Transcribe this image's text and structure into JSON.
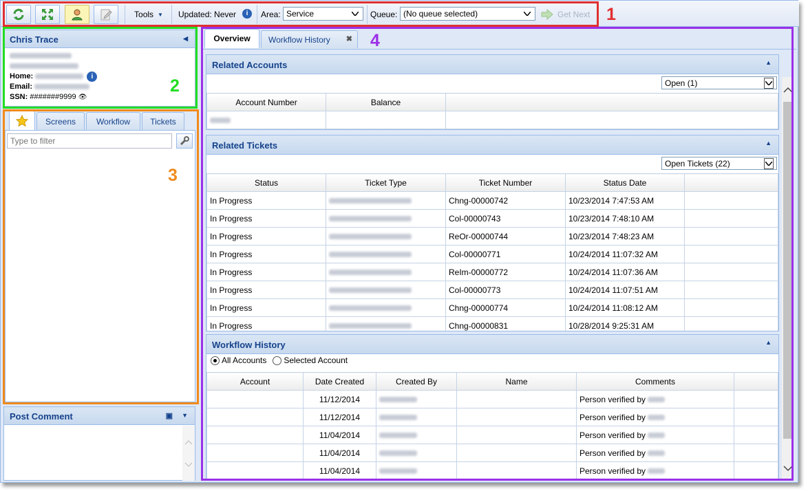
{
  "toolbar": {
    "tools_label": "Tools",
    "updated_label": "Updated: Never",
    "area_label": "Area:",
    "area_value": "Service",
    "queue_label": "Queue:",
    "queue_value": "(No queue selected)",
    "get_next_label": "Get Next"
  },
  "customer": {
    "name": "Chris Trace",
    "home_label": "Home:",
    "email_label": "Email:",
    "ssn_label": "SSN:",
    "ssn_value": "#######9999"
  },
  "left_tabs": [
    "Screens",
    "Workflow",
    "Tickets"
  ],
  "filter_placeholder": "Type to filter",
  "post_comment_title": "Post Comment",
  "main_tabs": {
    "overview": "Overview",
    "workflow_history": "Workflow History"
  },
  "related_accounts": {
    "title": "Related Accounts",
    "filter_value": "Open (1)",
    "columns": [
      "Account Number",
      "Balance"
    ]
  },
  "related_tickets": {
    "title": "Related Tickets",
    "filter_value": "Open Tickets (22)",
    "columns": [
      "Status",
      "Ticket Type",
      "Ticket Number",
      "Status Date"
    ],
    "rows": [
      {
        "status": "In Progress",
        "number": "Chng-00000742",
        "date": "10/23/2014 7:47:53 AM"
      },
      {
        "status": "In Progress",
        "number": "Col-00000743",
        "date": "10/23/2014 7:48:10 AM"
      },
      {
        "status": "In Progress",
        "number": "ReOr-00000744",
        "date": "10/23/2014 7:48:23 AM"
      },
      {
        "status": "In Progress",
        "number": "Col-00000771",
        "date": "10/24/2014 11:07:32 AM"
      },
      {
        "status": "In Progress",
        "number": "ReIm-00000772",
        "date": "10/24/2014 11:07:36 AM"
      },
      {
        "status": "In Progress",
        "number": "Col-00000773",
        "date": "10/24/2014 11:07:51 AM"
      },
      {
        "status": "In Progress",
        "number": "Chng-00000774",
        "date": "10/24/2014 11:08:12 AM"
      },
      {
        "status": "In Progress",
        "number": "Chng-00000831",
        "date": "10/28/2014 9:25:31 AM"
      }
    ]
  },
  "workflow_history": {
    "title": "Workflow History",
    "radio_all": "All Accounts",
    "radio_selected": "Selected Account",
    "columns": [
      "Account",
      "Date Created",
      "Created By",
      "Name",
      "Comments"
    ],
    "rows": [
      {
        "date": "11/12/2014",
        "comment": "Person verified by"
      },
      {
        "date": "11/12/2014",
        "comment": "Person verified by"
      },
      {
        "date": "11/04/2014",
        "comment": "Person verified by"
      },
      {
        "date": "11/04/2014",
        "comment": "Person verified by"
      },
      {
        "date": "11/04/2014",
        "comment": "Person verified by"
      }
    ]
  },
  "annotations": [
    "1",
    "2",
    "3",
    "4"
  ],
  "annotation_colors": {
    "1": "#e03030",
    "2": "#22dd22",
    "3": "#f08a1c",
    "4": "#9b30e8"
  }
}
